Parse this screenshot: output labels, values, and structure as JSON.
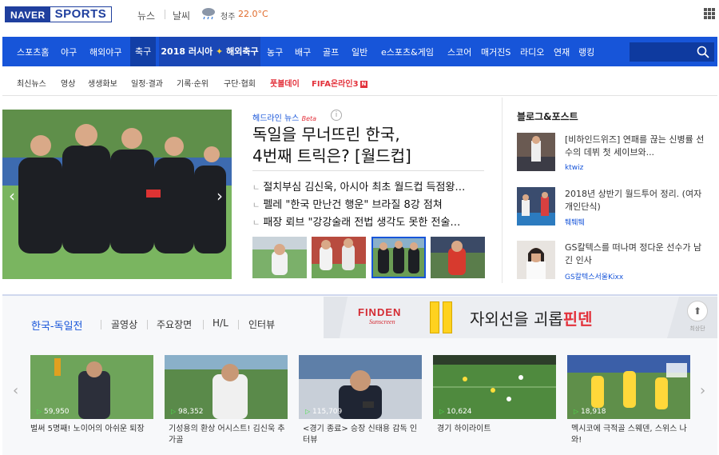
{
  "header": {
    "logo_naver": "NAVER",
    "logo_sports": "SPORTS",
    "links": [
      "뉴스",
      "날씨"
    ],
    "weather": {
      "city": "청주",
      "temp": "22.0°C"
    }
  },
  "nav": {
    "items": [
      "스포츠홈",
      "야구",
      "해외야구",
      "축구"
    ],
    "worldcup": {
      "prefix": "2018 러시아",
      "star": "✦",
      "suffix": "해외축구"
    },
    "items_right": [
      "농구",
      "배구",
      "골프",
      "일반",
      "e스포츠&게임",
      "스코어",
      "매거진S",
      "라디오",
      "연재",
      "랭킹"
    ]
  },
  "subnav": {
    "items": [
      "최신뉴스",
      "영상",
      "생생화보",
      "일정·결과",
      "기록·순위",
      "구단·협회"
    ],
    "red_items": [
      "풋볼데이",
      "FIFA온라인3"
    ],
    "badge": "N"
  },
  "headline": {
    "tag": "헤드라인 뉴스",
    "beta": "Beta",
    "info": "i",
    "title_line1": "독일을 무너뜨린 한국,",
    "title_line2": "4번째 트릭은? [월드컵]",
    "bullet": "ㄴ",
    "news": [
      "절치부심 김신욱, 아시아 최초 월드컵 득점왕…",
      "펠레 \"한국 만난건 행운\" 브라질 8강 점쳐",
      "패장 뢰브 \"강강술래 전법 생각도 못한 전술…"
    ]
  },
  "blog": {
    "title": "블로그&포스트",
    "items": [
      {
        "text": "[비하인드위즈] 연패를 끊는 신병률 선수의 데뷔 첫 세이브와...",
        "author": "ktwiz"
      },
      {
        "text": "2018년 상반기 월드투어 정리. (여자 개인단식)",
        "author": "퉤퉤퉤"
      },
      {
        "text": "GS칼텍스를 떠나며 정다운 선수가 남긴 인사",
        "author": "GS칼텍스서울Kixx"
      }
    ]
  },
  "tabs": [
    "한국-독일전",
    "골영상",
    "주요장면",
    "H/L",
    "인터뷰"
  ],
  "ad": {
    "brand": "FINDEN",
    "brand_script": "Sunscreen",
    "text": "자외선을 괴롭",
    "text_red": "핀덴"
  },
  "top_button": {
    "icon": "⬆",
    "label": "최상단"
  },
  "arrows": {
    "left": "‹",
    "right": "›"
  },
  "videos": [
    {
      "count": "59,950",
      "title": "벌써 5명째! 노이어의 아쉬운 퇴장"
    },
    {
      "count": "98,352",
      "title": "기성용의 환상 어시스트! 김신욱 추가골"
    },
    {
      "count": "115,709",
      "title": "<경기 종료> 승장 신태용 감독 인터뷰"
    },
    {
      "count": "10,624",
      "title": "경기 하이라이트"
    },
    {
      "count": "18,918",
      "title": "멕시코에 극적골 스웨덴, 스위스 나와!"
    }
  ],
  "colors": {
    "brand_blue": "#1755d9",
    "accent_red": "#e3323c"
  }
}
